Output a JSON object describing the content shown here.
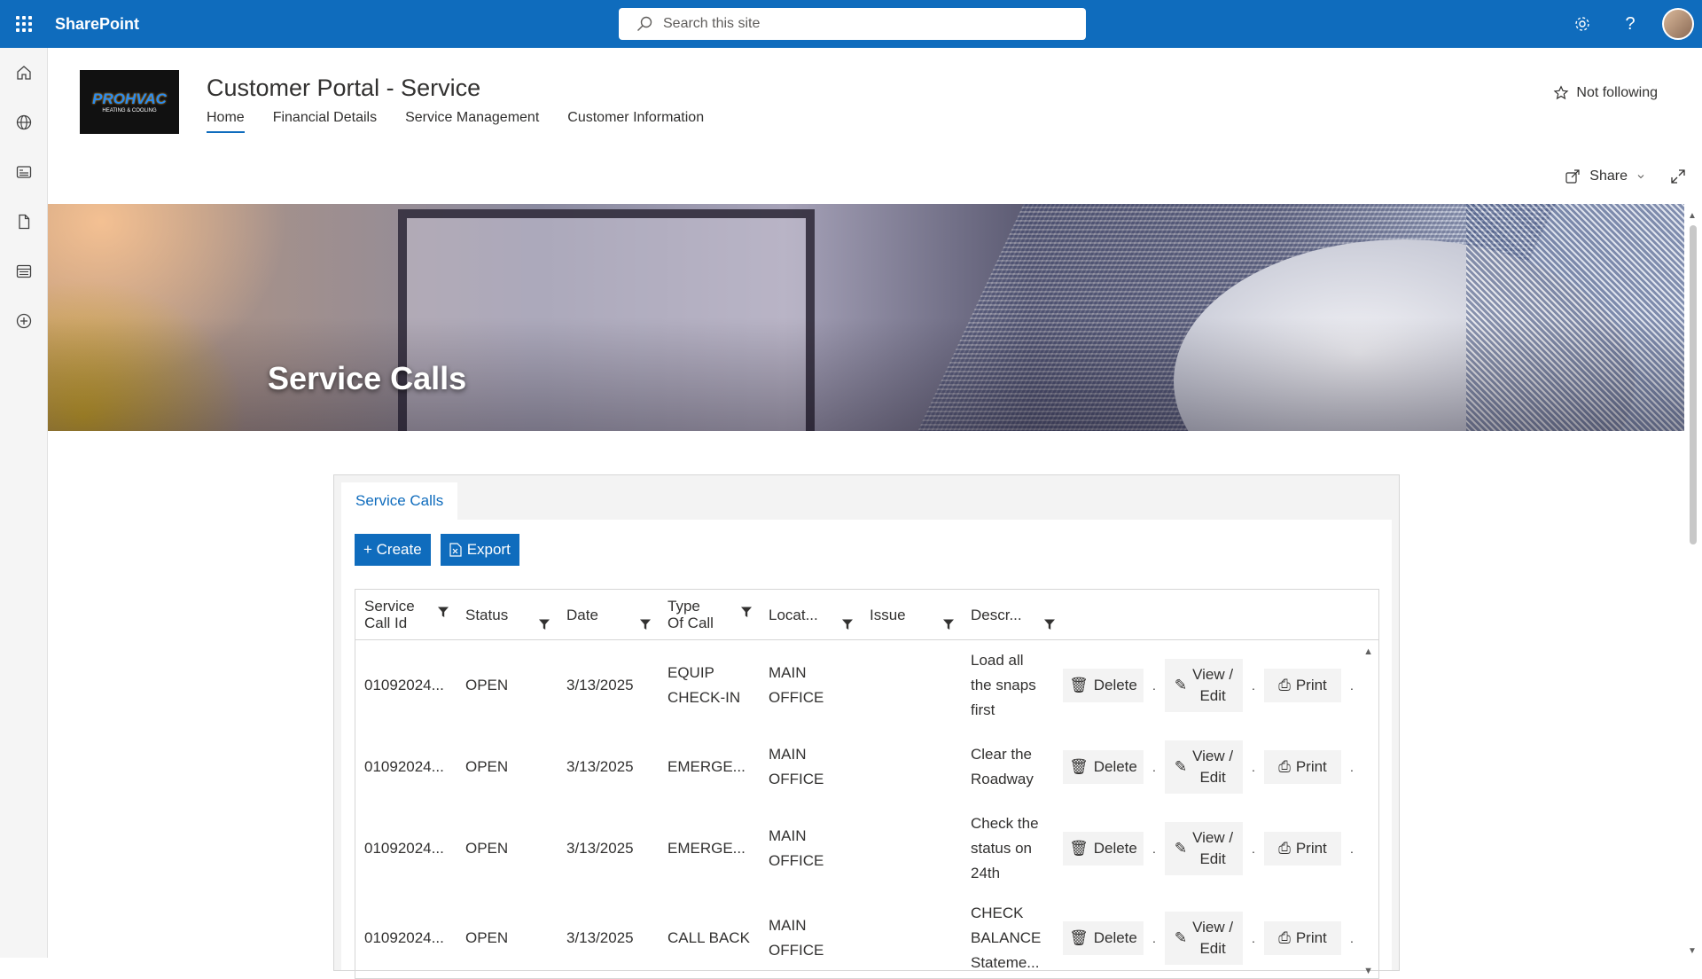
{
  "suite": {
    "app_name": "SharePoint",
    "search_placeholder": "Search this site"
  },
  "site": {
    "title": "Customer Portal - Service",
    "logo_text": "PROHVAC",
    "logo_subtext": "HEATING & COOLING",
    "nav": [
      "Home",
      "Financial Details",
      "Service Management",
      "Customer Information"
    ],
    "active_nav": "Home",
    "follow_label": "Not following",
    "share_label": "Share"
  },
  "hero": {
    "title": "Service Calls"
  },
  "webpart": {
    "tab_label": "Service Calls",
    "create_label": "+ Create",
    "export_label": "Export",
    "columns": [
      [
        "Service",
        "Call Id"
      ],
      [
        "Status"
      ],
      [
        "Date"
      ],
      [
        "Type",
        "Of Call"
      ],
      [
        "Locat..."
      ],
      [
        "Issue"
      ],
      [
        "Descr..."
      ]
    ],
    "rows": [
      {
        "id": "01092024...",
        "status": "OPEN",
        "date": "3/13/2025",
        "type": [
          "EQUIP",
          "CHECK-IN"
        ],
        "location": [
          "MAIN",
          "OFFICE"
        ],
        "issue": "",
        "desc": [
          "Load all",
          "the snaps",
          "first"
        ]
      },
      {
        "id": "01092024...",
        "status": "OPEN",
        "date": "3/13/2025",
        "type": [
          "EMERGE..."
        ],
        "location": [
          "MAIN",
          "OFFICE"
        ],
        "issue": "",
        "desc": [
          "Clear the",
          "Roadway"
        ]
      },
      {
        "id": "01092024...",
        "status": "OPEN",
        "date": "3/13/2025",
        "type": [
          "EMERGE..."
        ],
        "location": [
          "MAIN",
          "OFFICE"
        ],
        "issue": "",
        "desc": [
          "Check the",
          "status on",
          "24th"
        ]
      },
      {
        "id": "01092024...",
        "status": "OPEN",
        "date": "3/13/2025",
        "type": [
          "CALL BACK"
        ],
        "location": [
          "MAIN",
          "OFFICE"
        ],
        "issue": "",
        "desc": [
          "CHECK",
          "BALANCE",
          "Stateme..."
        ]
      }
    ],
    "actions": {
      "delete": "Delete",
      "view_edit": [
        "View /",
        "Edit"
      ],
      "print": "Print",
      "separator": "."
    }
  },
  "colors": {
    "suite_bar": "#0f6cbd",
    "accent": "#0f6cbd",
    "button_bg": "#0f6cbd"
  }
}
